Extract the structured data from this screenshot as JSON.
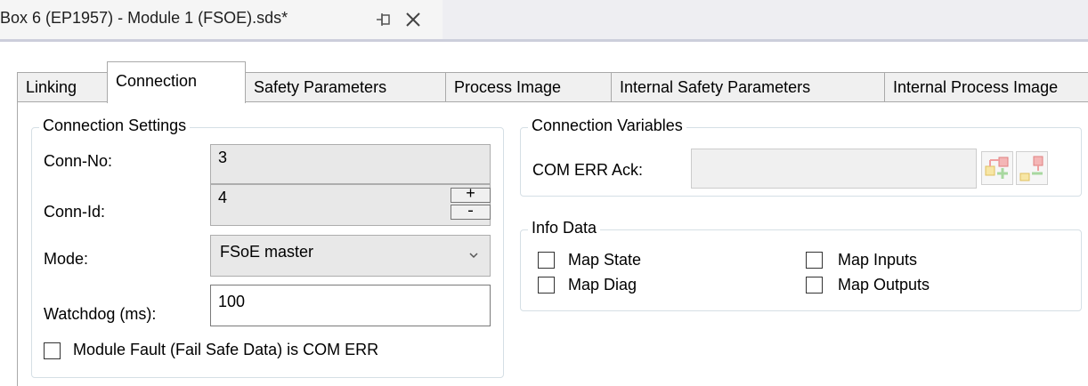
{
  "document_tab": {
    "title": "Box 6 (EP1957) - Module 1 (FSOE).sds*",
    "pin_glyph": "⊣⊢",
    "close_glyph": "✕"
  },
  "tabs": [
    {
      "label": "Linking"
    },
    {
      "label": "Connection"
    },
    {
      "label": "Safety Parameters"
    },
    {
      "label": "Process Image"
    },
    {
      "label": "Internal Safety Parameters"
    },
    {
      "label": "Internal Process Image"
    }
  ],
  "connection_settings": {
    "title": "Connection Settings",
    "conn_no_label": "Conn-No:",
    "conn_no_value": "3",
    "conn_id_label": "Conn-Id:",
    "conn_id_value": "4",
    "stepper_plus": "+",
    "stepper_minus": "-",
    "mode_label": "Mode:",
    "mode_value": "FSoE master",
    "watchdog_label": "Watchdog (ms):",
    "watchdog_value": "100",
    "module_fault_label": "Module Fault (Fail Safe Data) is COM ERR",
    "module_fault_checked": false
  },
  "connection_variables": {
    "title": "Connection Variables",
    "com_err_ack_label": "COM ERR Ack:",
    "com_err_ack_value": ""
  },
  "info_data": {
    "title": "Info Data",
    "map_state": "Map State",
    "map_diag": "Map Diag",
    "map_inputs": "Map Inputs",
    "map_outputs": "Map Outputs"
  }
}
